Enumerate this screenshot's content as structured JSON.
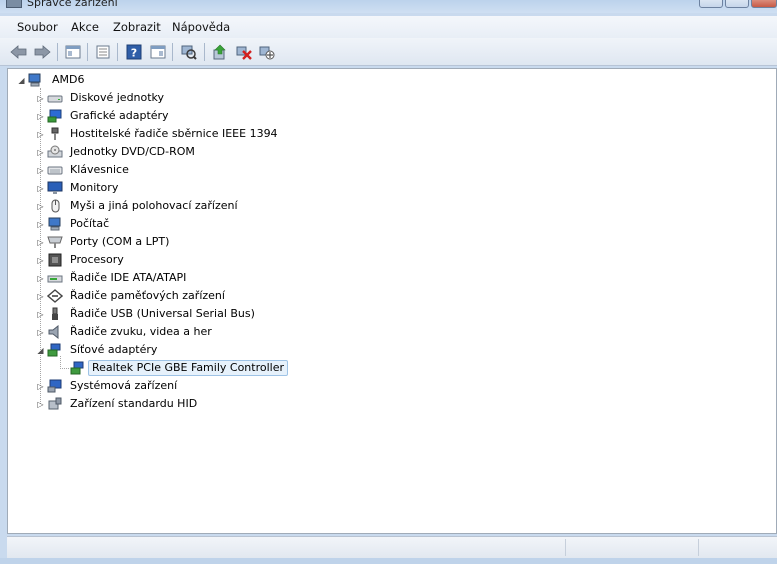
{
  "window": {
    "title": "Správce zařízení",
    "icon": "device-manager-icon"
  },
  "menu": [
    {
      "label": "Soubor"
    },
    {
      "label": "Akce"
    },
    {
      "label": "Zobrazit"
    },
    {
      "label": "Nápověda"
    }
  ],
  "toolbar": [
    {
      "icon": "back-arrow-icon"
    },
    {
      "icon": "forward-arrow-icon"
    },
    {
      "icon": "show-hide-console-tree-icon"
    },
    {
      "icon": "properties-icon"
    },
    {
      "icon": "help-icon"
    },
    {
      "icon": "action-pane-icon"
    },
    {
      "icon": "scan-hardware-icon"
    },
    {
      "icon": "update-driver-icon"
    },
    {
      "icon": "uninstall-icon"
    },
    {
      "icon": "disable-icon"
    }
  ],
  "tree": {
    "root": {
      "label": "AMD6",
      "icon": "computer-icon",
      "expanded": true
    },
    "categories": [
      {
        "label": "Diskové jednotky",
        "icon": "disk-drive-icon",
        "expanded": false
      },
      {
        "label": "Grafické adaptéry",
        "icon": "display-adapter-icon",
        "expanded": false
      },
      {
        "label": "Hostitelské řadiče sběrnice IEEE 1394",
        "icon": "ieee1394-icon",
        "expanded": false
      },
      {
        "label": "Jednotky DVD/CD-ROM",
        "icon": "dvd-drive-icon",
        "expanded": false
      },
      {
        "label": "Klávesnice",
        "icon": "keyboard-icon",
        "expanded": false
      },
      {
        "label": "Monitory",
        "icon": "monitor-icon",
        "expanded": false
      },
      {
        "label": "Myši a jiná polohovací zařízení",
        "icon": "mouse-icon",
        "expanded": false
      },
      {
        "label": "Počítač",
        "icon": "computer-icon",
        "expanded": false
      },
      {
        "label": "Porty (COM a LPT)",
        "icon": "port-icon",
        "expanded": false
      },
      {
        "label": "Procesory",
        "icon": "processor-icon",
        "expanded": false
      },
      {
        "label": "Řadiče IDE ATA/ATAPI",
        "icon": "ide-controller-icon",
        "expanded": false
      },
      {
        "label": "Řadiče paměťových zařízení",
        "icon": "storage-controller-icon",
        "expanded": false
      },
      {
        "label": "Řadiče USB (Universal Serial Bus)",
        "icon": "usb-icon",
        "expanded": false
      },
      {
        "label": "Řadiče zvuku, videa a her",
        "icon": "speaker-icon",
        "expanded": false
      },
      {
        "label": "Síťové adaptéry",
        "icon": "network-adapter-icon",
        "expanded": true,
        "children": [
          {
            "label": "Realtek PCIe GBE Family Controller",
            "icon": "network-adapter-icon",
            "selected": true
          }
        ]
      },
      {
        "label": "Systémová zařízení",
        "icon": "system-device-icon",
        "expanded": false
      },
      {
        "label": "Zařízení standardu HID",
        "icon": "hid-icon",
        "expanded": false
      }
    ]
  },
  "colors": {
    "selection_fill": "#e6f1fb",
    "selection_border": "#9ec3e6",
    "chrome": "#c9daee"
  }
}
